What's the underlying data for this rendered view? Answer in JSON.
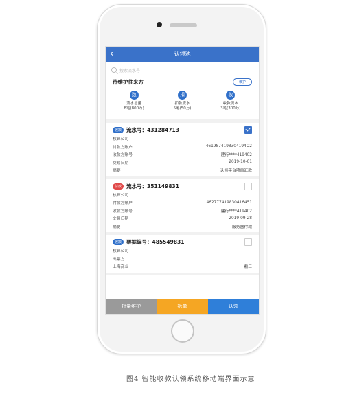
{
  "nav": {
    "back": "‹",
    "title": "认领池"
  },
  "search": {
    "placeholder": "搜索流水号"
  },
  "section": {
    "title": "待维护往来方",
    "button": "维护"
  },
  "stats": [
    {
      "icon": "数",
      "label": "流水总量",
      "value": "8笔(800万)"
    },
    {
      "icon": "扣",
      "label": "扣款流水",
      "value": "5笔(50万)"
    },
    {
      "icon": "收",
      "label": "收款流水",
      "value": "3笔(300万)"
    }
  ],
  "cards": [
    {
      "tag": "收款",
      "tag_color": "#2f6fc9",
      "checked": true,
      "serial": "流水号：431284713",
      "rows": [
        {
          "k": "核算公司",
          "v": ""
        },
        {
          "k": "付款方账户",
          "v": "4619874198304194O2"
        },
        {
          "k": "收款方账号",
          "v": "建行****419402"
        },
        {
          "k": "交易日期",
          "v": "2019-10-01"
        },
        {
          "k": "摘要",
          "v": "认领平台项目汇款"
        }
      ]
    },
    {
      "tag": "付款",
      "tag_color": "#e04848",
      "checked": false,
      "serial": "流水号：351149831",
      "rows": [
        {
          "k": "核算公司",
          "v": ""
        },
        {
          "k": "付款方账户",
          "v": "462777419830416451"
        },
        {
          "k": "收款方账号",
          "v": "建行****419402"
        },
        {
          "k": "交易日期",
          "v": "2019-09-28"
        },
        {
          "k": "摘要",
          "v": "服务器付款"
        }
      ]
    },
    {
      "tag": "收款",
      "tag_color": "#2f6fc9",
      "checked": false,
      "serial": "票据编号：485549831",
      "rows": [
        {
          "k": "核算公司",
          "v": ""
        },
        {
          "k": "出票方",
          "v": ""
        },
        {
          "k": "上海商业",
          "v": "鼎三"
        }
      ]
    }
  ],
  "bottom": {
    "batch": "批量维护",
    "split": "拆单",
    "claim": "认领"
  },
  "caption": "图4 智能收款认领系统移动端界面示意"
}
